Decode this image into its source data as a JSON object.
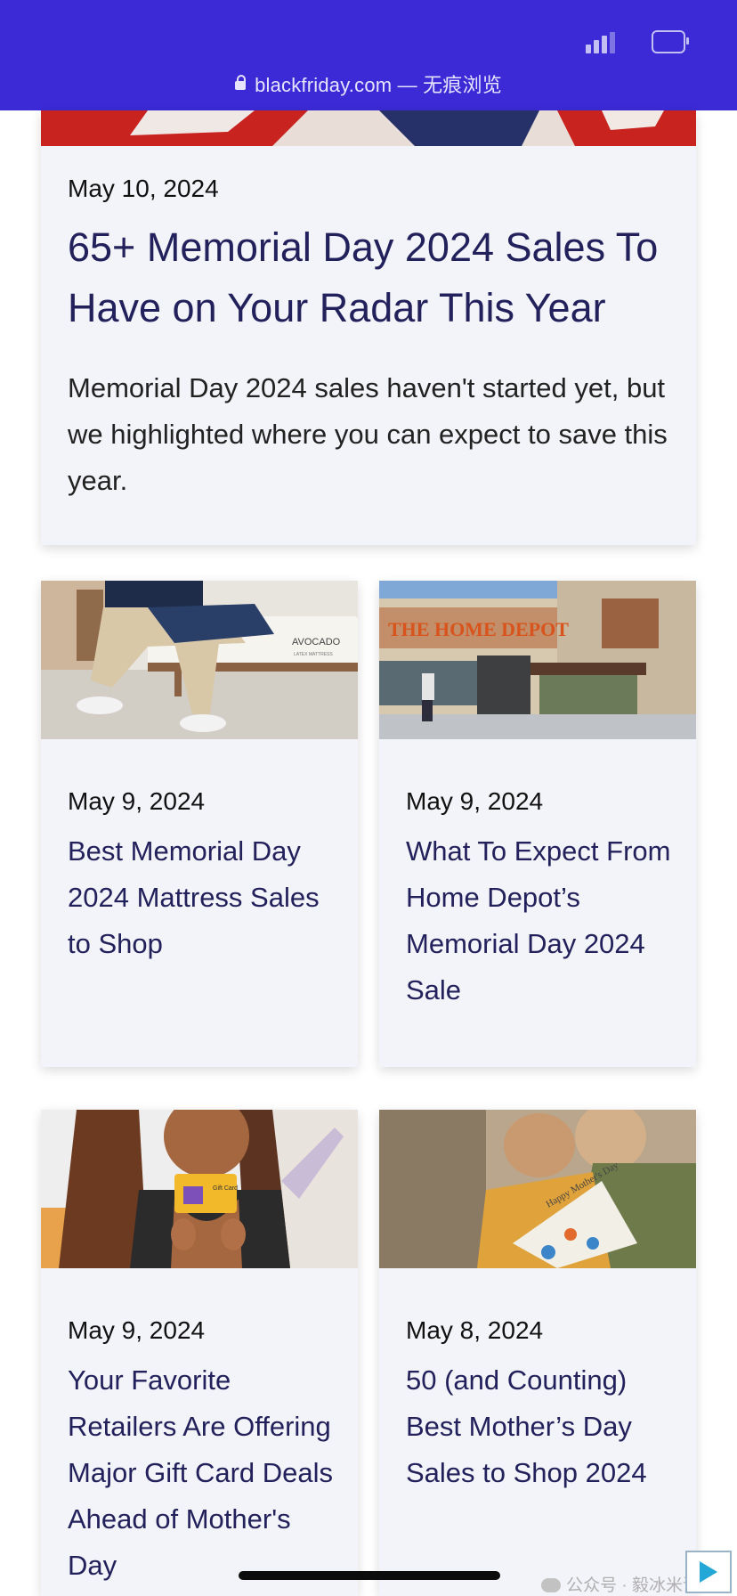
{
  "browser": {
    "url": "blackfriday.com",
    "mode_label": "— 无痕浏览"
  },
  "featured": {
    "date": "May 10, 2024",
    "title": "65+ Memorial Day 2024 Sales To Have on Your Radar This Year",
    "description": "Memorial Day 2024 sales haven't started yet, but we highlighted where you can expect to save this year."
  },
  "articles": [
    {
      "date": "May 9, 2024",
      "title": "Best Memorial Day 2024 Mattress Sales to Shop",
      "image_text": "AVOCADO",
      "image_subtext": "LATEX MATTRESS"
    },
    {
      "date": "May 9, 2024",
      "title": "What To Expect From Home Depot’s Memorial Day 2024 Sale",
      "image_text": "THE HOME DEPOT"
    },
    {
      "date": "May 9, 2024",
      "title": "Your Favorite Retailers Are Offering Major Gift Card Deals Ahead of Mother's Day",
      "image_text": "Gift Card"
    },
    {
      "date": "May 8, 2024",
      "title": "50 (and Counting) Best Mother’s Day Sales to Shop 2024",
      "image_text": "Happy Mother's Day"
    }
  ],
  "watermark": {
    "text": "公众号 · 毅冰米课"
  },
  "colors": {
    "header_bg": "#3b2ad6",
    "card_bg": "#f3f3fa",
    "title_color": "#22215b"
  },
  "icons": [
    "lock-icon",
    "signal-icon",
    "battery-icon",
    "wechat-icon",
    "play-icon"
  ]
}
